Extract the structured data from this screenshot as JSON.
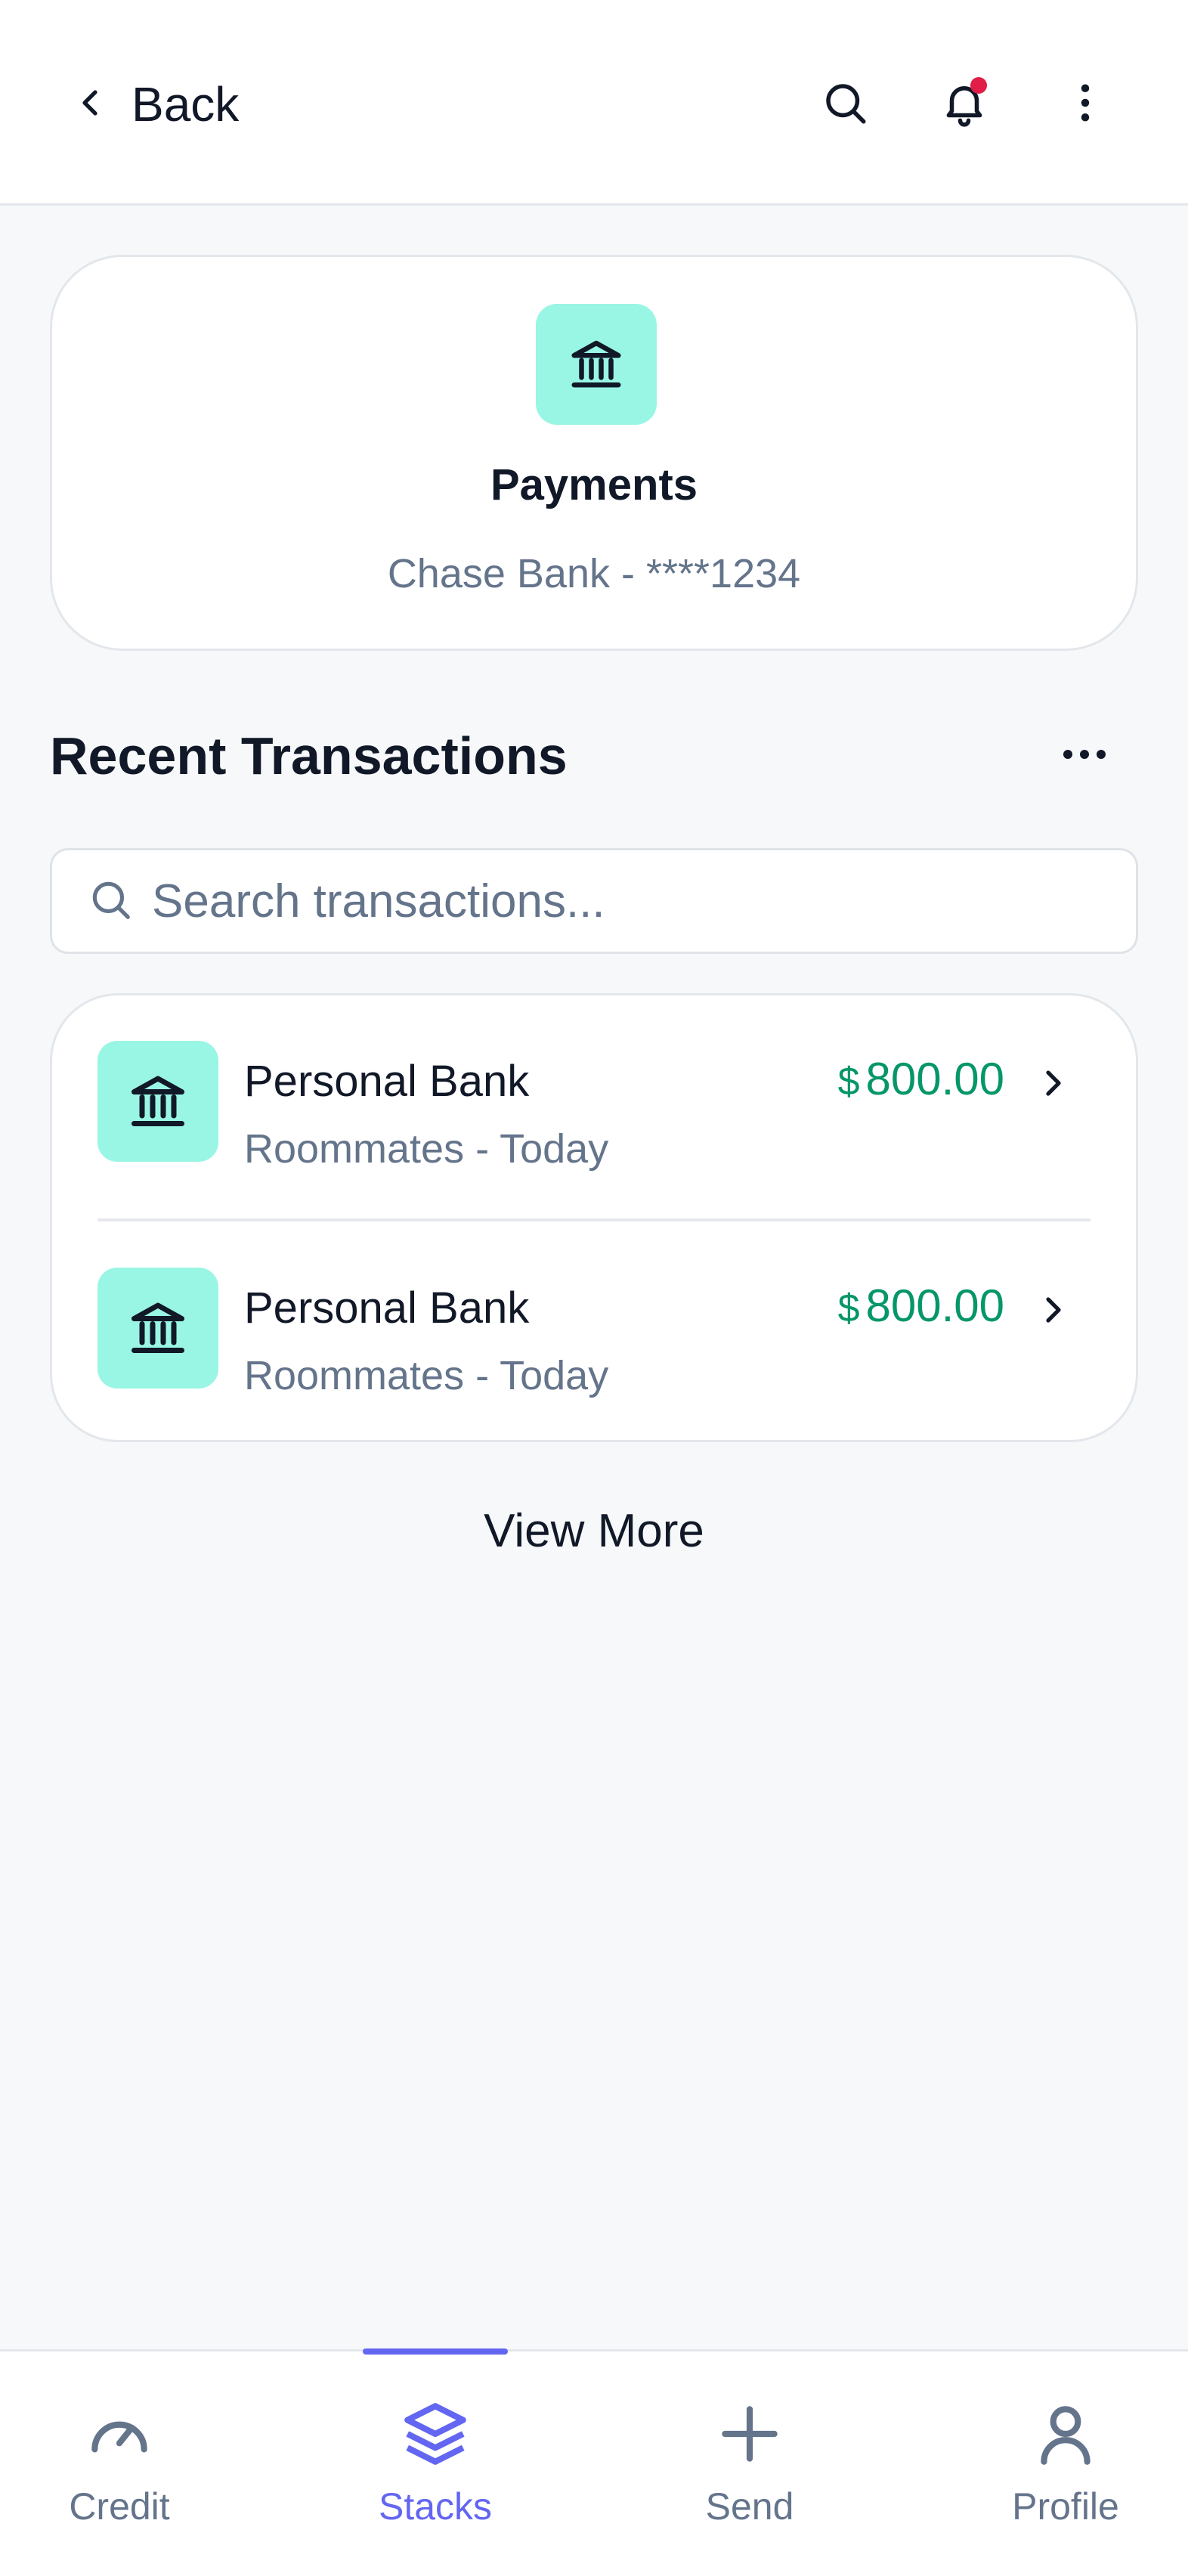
{
  "header": {
    "back_label": "Back",
    "icons": [
      "chevron-left-icon",
      "search-icon",
      "bell-icon",
      "more-vertical-icon"
    ],
    "notification_dot_color": "#e11d48"
  },
  "account": {
    "icon": "bank-icon",
    "title": "Payments",
    "subtitle": "Chase Bank - ****1234",
    "tile_color": "#99f6e4"
  },
  "transactions_section": {
    "title": "Recent Transactions",
    "more_icon": "more-horizontal-icon",
    "search_placeholder": "Search transactions...",
    "items": [
      {
        "name": "Personal Bank",
        "meta": "Roommates - Today",
        "currency": "$",
        "amount": "800.00",
        "icon": "bank-icon"
      },
      {
        "name": "Personal Bank",
        "meta": "Roommates - Today",
        "currency": "$",
        "amount": "800.00",
        "icon": "bank-icon"
      }
    ],
    "amount_color": "#059669",
    "view_more": "View More"
  },
  "bottom_nav": {
    "active_color": "#6366f1",
    "items": [
      {
        "label": "Credit",
        "icon": "gauge-icon",
        "active": false
      },
      {
        "label": "Stacks",
        "icon": "layers-icon",
        "active": true
      },
      {
        "label": "Send",
        "icon": "plus-icon",
        "active": false
      },
      {
        "label": "Profile",
        "icon": "user-icon",
        "active": false
      }
    ]
  }
}
